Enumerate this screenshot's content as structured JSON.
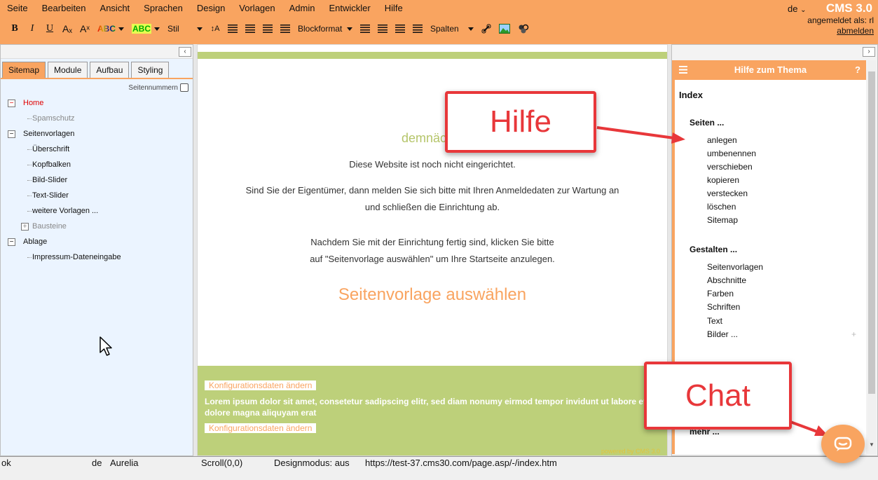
{
  "menu": [
    "Seite",
    "Bearbeiten",
    "Ansicht",
    "Sprachen",
    "Design",
    "Vorlagen",
    "Admin",
    "Entwickler",
    "Hilfe"
  ],
  "toolbar": {
    "bold": "B",
    "italic": "I",
    "underline": "U",
    "subscript": "Aₓ",
    "superscript": "Aˣ",
    "font_color_label": "ABC",
    "bg_color_label": "ABC",
    "style_label": "Stil",
    "blockformat_label": "Blockformat",
    "columns_label": "Spalten"
  },
  "header": {
    "language": "de",
    "brand": "CMS 3.0",
    "logged_in": "angemeldet als: rl",
    "logout": "abmelden"
  },
  "left": {
    "tabs": [
      "Sitemap",
      "Module",
      "Aufbau",
      "Styling"
    ],
    "active_tab": "Sitemap",
    "page_numbers_label": "Seitennummern",
    "tree": [
      {
        "label": "Home"
      },
      {
        "label": "Spamschutz"
      },
      {
        "label": "Seitenvorlagen"
      },
      {
        "label": "Überschrift"
      },
      {
        "label": "Kopfbalken"
      },
      {
        "label": "Bild-Slider"
      },
      {
        "label": "Text-Slider"
      },
      {
        "label": "weitere Vorlagen ..."
      },
      {
        "label": "Bausteine"
      },
      {
        "label": "Ablage"
      },
      {
        "label": "Impressum-Dateneingabe"
      }
    ]
  },
  "center": {
    "coming_soon": "demnächst",
    "line1": "Diese Website ist noch nicht eingerichtet.",
    "line2": "Sind Sie der Eigentümer, dann melden Sie sich bitte mit Ihren Anmeldedaten zur Wartung an",
    "line3": "und schließen die Einrichtung ab.",
    "line4": "Nachdem Sie mit der Einrichtung fertig sind, klicken Sie bitte",
    "line5": "auf \"Seitenvorlage auswählen\" um Ihre Startseite anzulegen.",
    "choose_template": "Seitenvorlage auswählen",
    "config_link1": "Konfigurationsdaten ändern",
    "lorem": "Lorem ipsum dolor sit amet, consetetur sadipscing elitr, sed diam nonumy eirmod tempor invidunt ut labore et dolore magna aliquyam erat",
    "config_link2": "Konfigurationsdaten ändern",
    "powered_by": "powered by CMS 3.0"
  },
  "help": {
    "title": "Hilfe zum Thema",
    "question": "?",
    "index": "Index",
    "pages_heading": "Seiten ...",
    "pages_items": [
      "anlegen",
      "umbenennen",
      "verschieben",
      "kopieren",
      "verstecken",
      "löschen",
      "Sitemap"
    ],
    "design_heading": "Gestalten ...",
    "design_items": [
      "Seitenvorlagen",
      "Abschnitte",
      "Farben",
      "Schriften",
      "Text",
      "Bilder ..."
    ],
    "plus": "+",
    "more": "mehr ..."
  },
  "callouts": {
    "help": "Hilfe",
    "chat": "Chat"
  },
  "status": {
    "state": "ok",
    "language": "de",
    "theme": "Aurelia",
    "scroll": "Scroll(0,0)",
    "mode": "Designmodus: aus",
    "url": "https://test-37.cms30.com/page.asp/-/index.htm"
  },
  "colors": {
    "accent": "#f9a460",
    "green": "#bdd07a",
    "callout": "#e8373a",
    "tree_bg": "#ebf4ff"
  }
}
